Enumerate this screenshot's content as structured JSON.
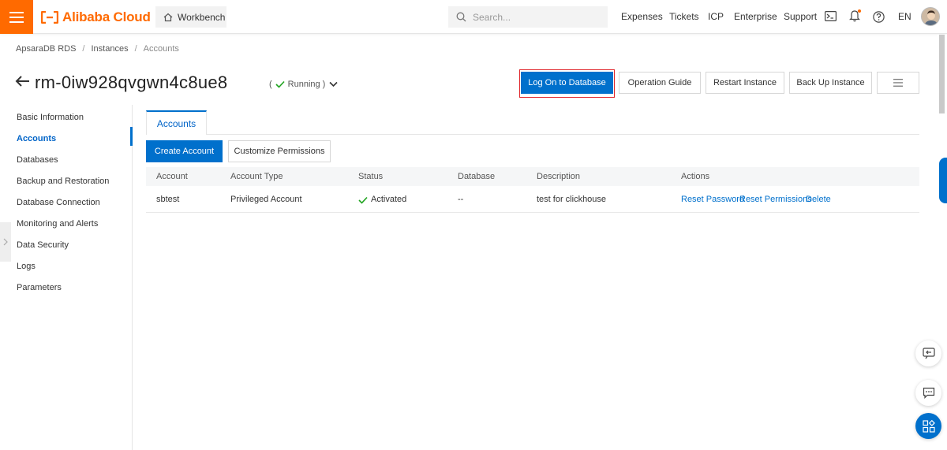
{
  "header": {
    "brand": "Alibaba Cloud",
    "workbench": "Workbench",
    "search_placeholder": "Search...",
    "nav": [
      "Expenses",
      "Tickets",
      "ICP",
      "Enterprise",
      "Support"
    ],
    "language": "EN"
  },
  "breadcrumb": [
    "ApsaraDB RDS",
    "Instances",
    "Accounts"
  ],
  "instance": {
    "id": "rm-0iw928qvgwn4c8ue8",
    "status_open": "(",
    "status": "Running",
    "status_close": ")"
  },
  "actions": {
    "log_on": "Log On to Database",
    "guide": "Operation Guide",
    "restart": "Restart Instance",
    "backup": "Back Up Instance"
  },
  "sidebar": {
    "items": [
      "Basic Information",
      "Accounts",
      "Databases",
      "Backup and Restoration",
      "Database Connection",
      "Monitoring and Alerts",
      "Data Security",
      "Logs",
      "Parameters"
    ],
    "active": "Accounts"
  },
  "main": {
    "tab": "Accounts",
    "create_account": "Create Account",
    "customize_permissions": "Customize Permissions",
    "columns": [
      "Account",
      "Account Type",
      "Status",
      "Database",
      "Description",
      "Actions"
    ],
    "rows": [
      {
        "account": "sbtest",
        "type": "Privileged Account",
        "status": "Activated",
        "database": "--",
        "description": "test for clickhouse",
        "actions": [
          "Reset Password",
          "Reset Permissions",
          "Delete"
        ]
      }
    ]
  },
  "colors": {
    "brand_orange": "#ff6a00",
    "primary_blue": "#0070cc",
    "success_green": "#1fa31f",
    "highlight_red": "#e0262c"
  },
  "icons": [
    "menu-icon",
    "home-icon",
    "search-icon",
    "terminal-icon",
    "bell-icon",
    "help-icon",
    "back-arrow-icon",
    "check-icon",
    "chevron-down-icon",
    "list-icon",
    "feedback-icon",
    "chat-icon",
    "apps-icon"
  ]
}
